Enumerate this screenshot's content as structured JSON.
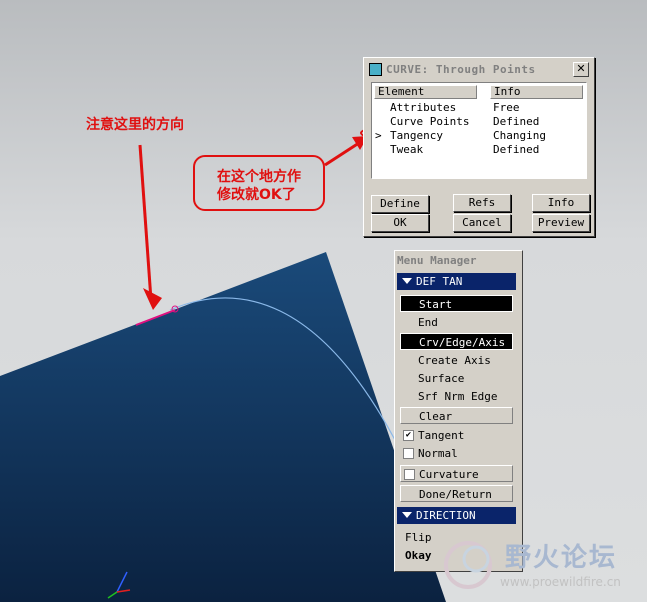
{
  "annotations": {
    "direction_note": "注意这里的方向",
    "modify_line1": "在这个地方作",
    "modify_line2": "修改就OK了"
  },
  "curve_dialog": {
    "title": "CURVE: Through Points",
    "col_element": "Element",
    "col_info": "Info",
    "rows": [
      {
        "arrow": "",
        "element": "Attributes",
        "info": "Free"
      },
      {
        "arrow": "",
        "element": "Curve Points",
        "info": "Defined"
      },
      {
        "arrow": ">",
        "element": "Tangency",
        "info": "Changing"
      },
      {
        "arrow": "",
        "element": "Tweak",
        "info": "Defined"
      }
    ],
    "buttons": {
      "define": "Define",
      "refs": "Refs",
      "info": "Info",
      "ok": "OK",
      "cancel": "Cancel",
      "preview": "Preview"
    }
  },
  "menu_manager": {
    "title": "Menu Manager",
    "def_tan_header": "DEF TAN",
    "items": {
      "start": "Start",
      "end": "End",
      "crv_edge_axis": "Crv/Edge/Axis",
      "create_axis": "Create Axis",
      "surface": "Surface",
      "srf_nrm_edge": "Srf Nrm Edge",
      "clear": "Clear",
      "tangent": "Tangent",
      "normal": "Normal",
      "curvature": "Curvature",
      "done_return": "Done/Return"
    },
    "checks": {
      "tangent": true,
      "normal": false,
      "curvature": false
    },
    "direction_header": "DIRECTION",
    "flip": "Flip",
    "okay": "Okay"
  },
  "watermark": {
    "title": "野火论坛",
    "url": "www.proewildfire.cn"
  },
  "colors": {
    "surface_dark": "#0d2a4d",
    "surface_light": "#1a4a7a",
    "annotation": "#e01010",
    "menu_header": "#0a246a"
  }
}
